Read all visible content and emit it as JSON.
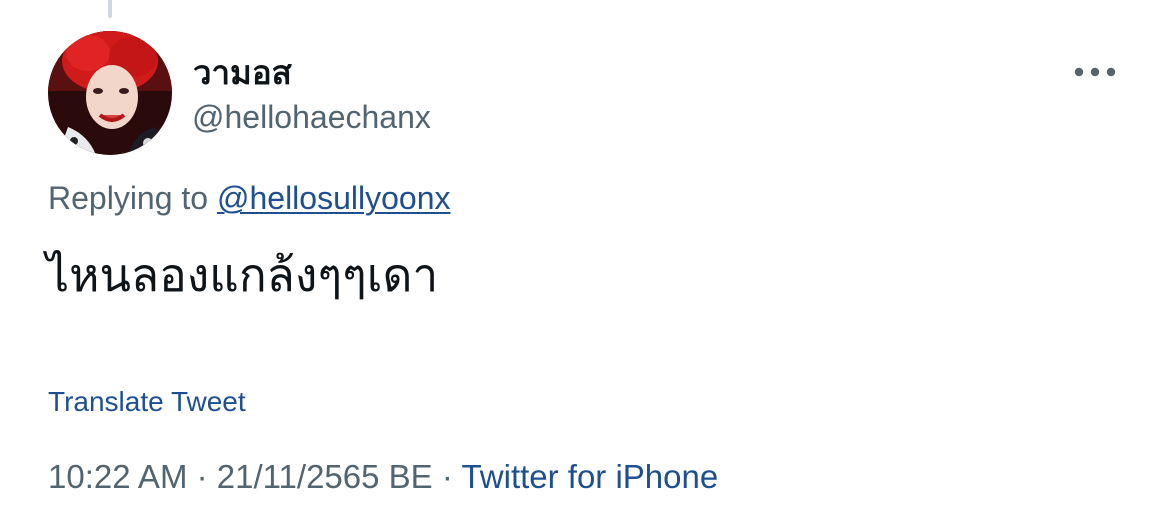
{
  "tweet": {
    "author": {
      "display_name": "วามอส",
      "handle": "@hellohaechanx",
      "avatar_icon": "profile-photo"
    },
    "more_icon": "more-horizontal-icon",
    "replying": {
      "prefix": "Replying to",
      "handle": "@hellosullyoonx"
    },
    "text": "ไหนลองแกล้งๆๆเดา",
    "translate_label": "Translate Tweet",
    "meta": {
      "time": "10:22 AM",
      "separator": "·",
      "date": "21/11/2565 BE",
      "source": "Twitter for iPhone"
    },
    "colors": {
      "text_primary": "#0f1419",
      "text_secondary": "#536471",
      "link": "#1d4f91",
      "thread_line": "#cfd9de"
    }
  }
}
